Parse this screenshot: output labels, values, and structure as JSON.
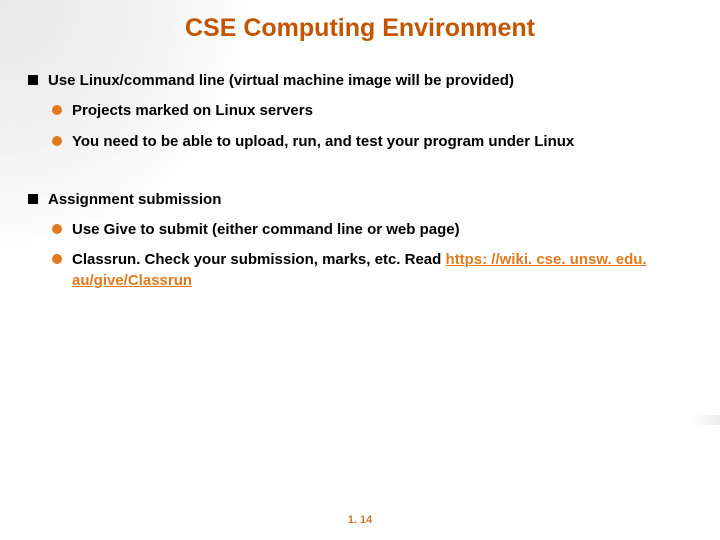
{
  "title": "CSE Computing Environment",
  "section1": {
    "heading": "Use Linux/command line (virtual machine image will be provided)",
    "bullet1": "Projects marked on Linux servers",
    "bullet2": "You need to be able to upload, run, and test your program under Linux"
  },
  "section2": {
    "heading": "Assignment submission",
    "bullet1": "Use Give to submit (either command line or web page)",
    "bullet2_prefix": "Classrun. Check your submission, marks, etc. Read ",
    "bullet2_link": "https: //wiki. cse. unsw. edu. au/give/Classrun"
  },
  "page_number": "1. 14"
}
